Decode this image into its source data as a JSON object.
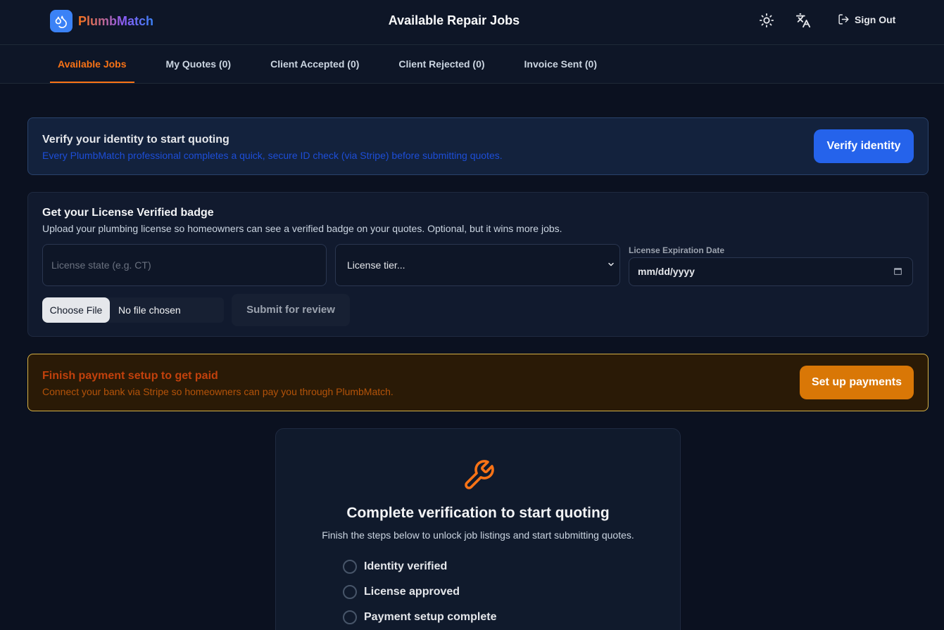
{
  "header": {
    "brand": "PlumbMatch",
    "title": "Available Repair Jobs",
    "sign_out": "Sign Out"
  },
  "tabs": [
    {
      "label": "Available Jobs",
      "active": true
    },
    {
      "label": "My Quotes (0)"
    },
    {
      "label": "Client Accepted (0)"
    },
    {
      "label": "Client Rejected (0)"
    },
    {
      "label": "Invoice Sent (0)"
    }
  ],
  "verify": {
    "title": "Verify your identity to start quoting",
    "subtitle": "Every PlumbMatch professional completes a quick, secure ID check (via Stripe) before submitting quotes.",
    "button": "Verify identity"
  },
  "license": {
    "title": "Get your License Verified badge",
    "subtitle": "Upload your plumbing license so homeowners can see a verified badge on your quotes. Optional, but it wins more jobs.",
    "state_placeholder": "License state (e.g. CT)",
    "tier_selected": "License tier...",
    "date_label": "License Expiration Date",
    "date_placeholder": "mm/dd/yyyy",
    "choose_file": "Choose File",
    "no_file": "No file chosen",
    "submit": "Submit for review"
  },
  "payment": {
    "title": "Finish payment setup to get paid",
    "subtitle": "Connect your bank via Stripe so homeowners can pay you through PlumbMatch.",
    "button": "Set up payments"
  },
  "gate": {
    "title": "Complete verification to start quoting",
    "subtitle": "Finish the steps below to unlock job listings and start submitting quotes.",
    "steps": [
      {
        "label": "Identity verified"
      },
      {
        "label": "License approved"
      },
      {
        "label": "Payment setup complete"
      }
    ]
  },
  "colors": {
    "accent": "#f97316",
    "primary": "#2563eb",
    "warning": "#d97706",
    "background": "#0b1120"
  }
}
